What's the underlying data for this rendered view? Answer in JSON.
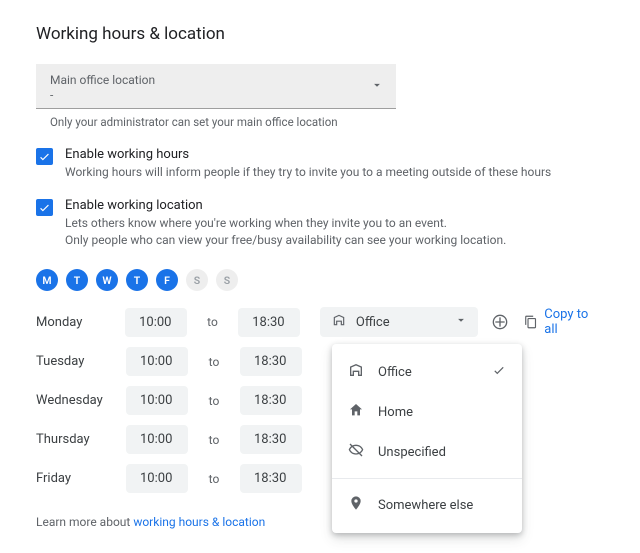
{
  "title": "Working hours & location",
  "main_location": {
    "label": "Main office location",
    "value": "-",
    "helper": "Only your administrator can set your main office location"
  },
  "enable_hours": {
    "title": "Enable working hours",
    "desc": "Working hours will inform people if they try to invite you to a meeting outside of these hours"
  },
  "enable_location": {
    "title": "Enable working location",
    "desc1": "Lets others know where you're working when they invite you to an event.",
    "desc2": "Only people who can view your free/busy availability can see your working location."
  },
  "day_chips": [
    "M",
    "T",
    "W",
    "T",
    "F",
    "S",
    "S"
  ],
  "to_label": "to",
  "schedule": [
    {
      "day": "Monday",
      "start": "10:00",
      "end": "18:30",
      "loc": "Office"
    },
    {
      "day": "Tuesday",
      "start": "10:00",
      "end": "18:30"
    },
    {
      "day": "Wednesday",
      "start": "10:00",
      "end": "18:30"
    },
    {
      "day": "Thursday",
      "start": "10:00",
      "end": "18:30"
    },
    {
      "day": "Friday",
      "start": "10:00",
      "end": "18:30"
    }
  ],
  "copy_all": "Copy to all",
  "menu": {
    "office": "Office",
    "home": "Home",
    "unspecified": "Unspecified",
    "somewhere": "Somewhere else"
  },
  "learn_prefix": "Learn more about ",
  "learn_link": "working hours & location"
}
